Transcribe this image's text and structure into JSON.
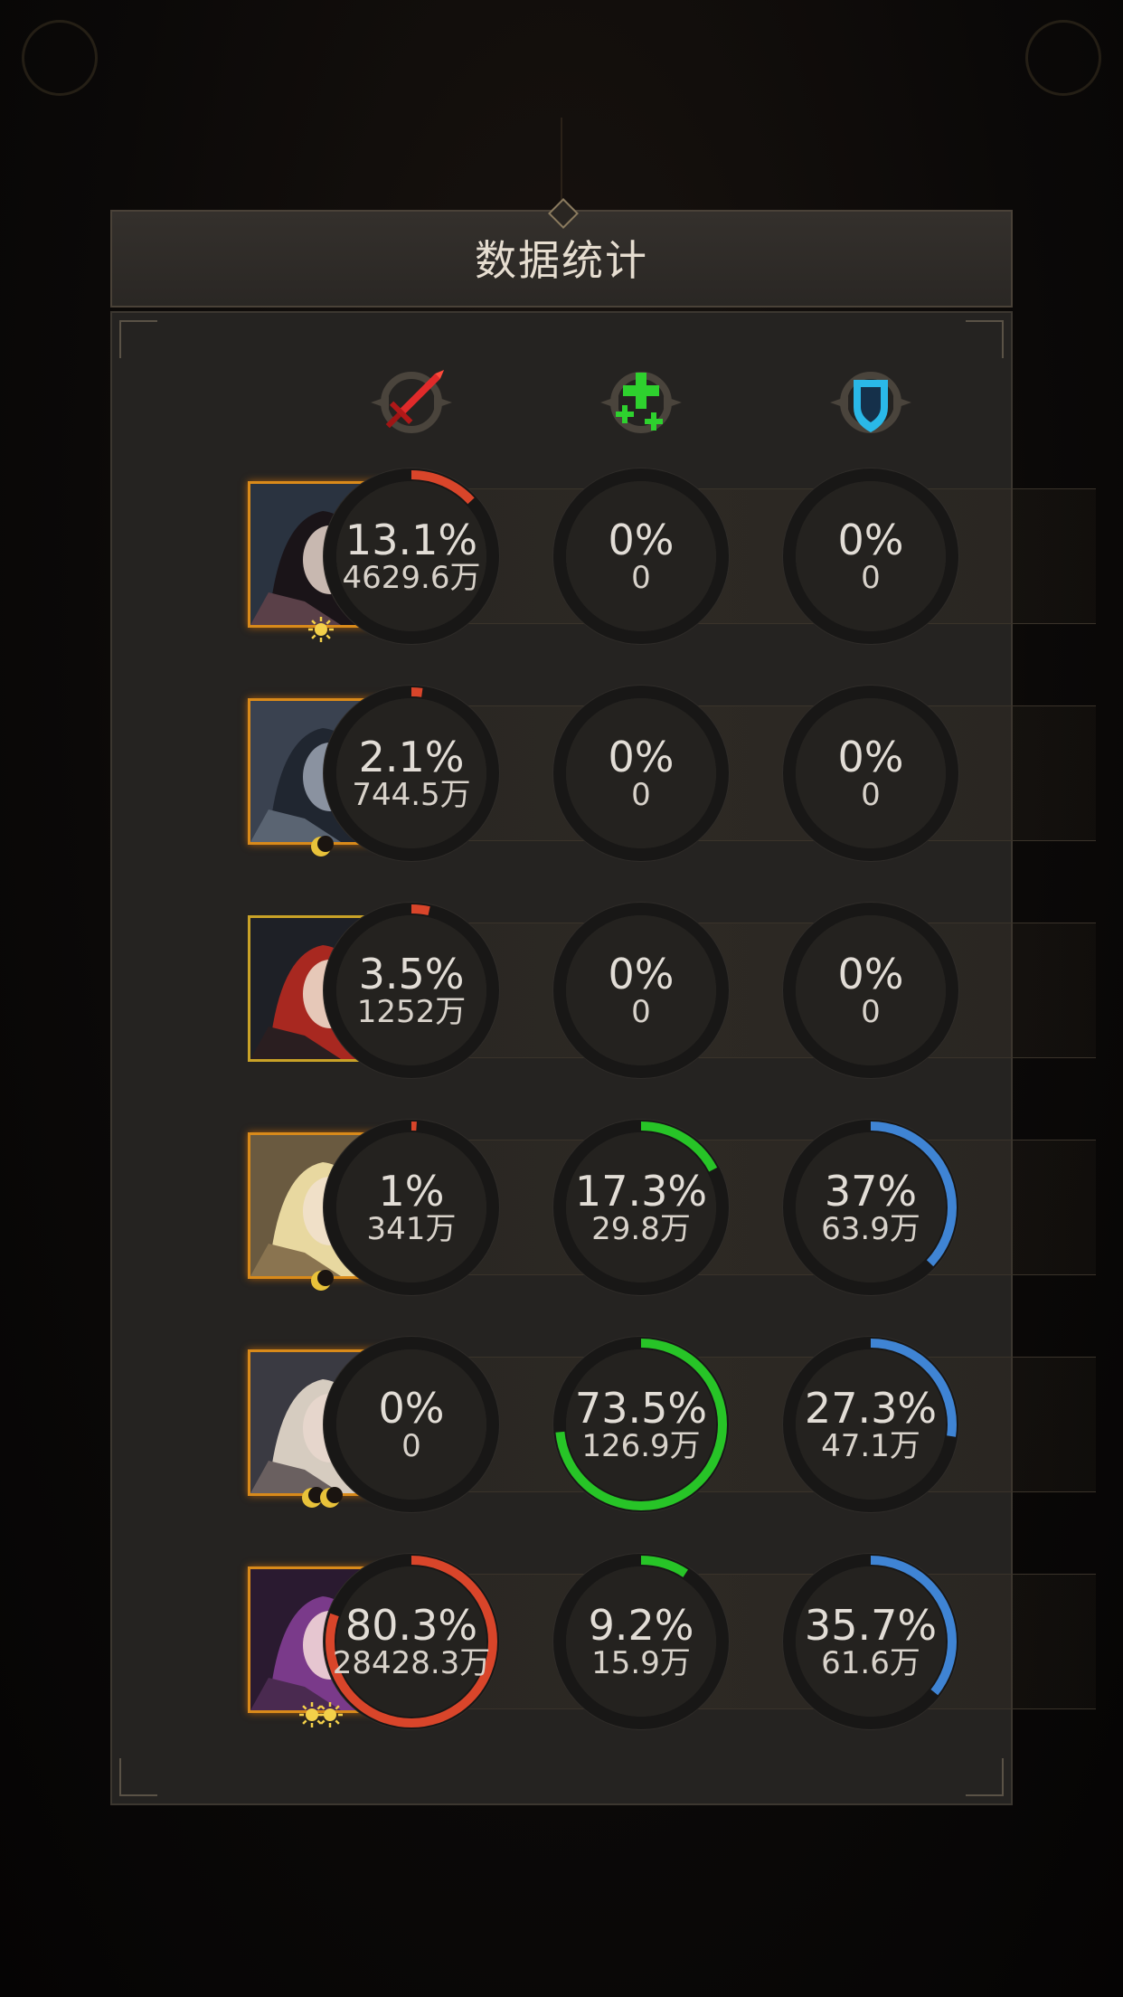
{
  "dialog": {
    "title": "数据统计"
  },
  "columns": [
    {
      "icon": "sword-icon",
      "color": "#e02a2a"
    },
    {
      "icon": "heal-plus-icon",
      "color": "#2ed12e"
    },
    {
      "icon": "shield-icon",
      "color": "#2ab8e8"
    }
  ],
  "ring_colors": {
    "damage": "#d9452a",
    "heal": "#27c427",
    "shield": "#3f84d4",
    "track": "#181716"
  },
  "rows": [
    {
      "portrait": "hero-dark-sorceress-portrait",
      "badge": "sun-badge-icon",
      "damage": {
        "pct": "13.1%",
        "value": "4629.6万",
        "fraction": 0.131
      },
      "heal": {
        "pct": "0%",
        "value": "0",
        "fraction": 0
      },
      "shield": {
        "pct": "0%",
        "value": "0",
        "fraction": 0
      }
    },
    {
      "portrait": "hero-werewolf-portrait",
      "badge": "moon-badge-icon",
      "damage": {
        "pct": "2.1%",
        "value": "744.5万",
        "fraction": 0.021
      },
      "heal": {
        "pct": "0%",
        "value": "0",
        "fraction": 0
      },
      "shield": {
        "pct": "0%",
        "value": "0",
        "fraction": 0
      }
    },
    {
      "portrait": "hero-red-hair-portrait",
      "badge": "",
      "damage": {
        "pct": "3.5%",
        "value": "1252万",
        "fraction": 0.035
      },
      "heal": {
        "pct": "0%",
        "value": "0",
        "fraction": 0
      },
      "shield": {
        "pct": "0%",
        "value": "0",
        "fraction": 0
      }
    },
    {
      "portrait": "hero-blonde-elf-portrait",
      "badge": "moon-badge-icon",
      "damage": {
        "pct": "1%",
        "value": "341万",
        "fraction": 0.01
      },
      "heal": {
        "pct": "17.3%",
        "value": "29.8万",
        "fraction": 0.173
      },
      "shield": {
        "pct": "37%",
        "value": "63.9万",
        "fraction": 0.37
      }
    },
    {
      "portrait": "hero-silver-hair-portrait",
      "badge": "double-moon-badge-icon",
      "damage": {
        "pct": "0%",
        "value": "0",
        "fraction": 0
      },
      "heal": {
        "pct": "73.5%",
        "value": "126.9万",
        "fraction": 0.735
      },
      "shield": {
        "pct": "27.3%",
        "value": "47.1万",
        "fraction": 0.273
      }
    },
    {
      "portrait": "hero-violet-witch-portrait",
      "badge": "double-sun-badge-icon",
      "damage": {
        "pct": "80.3%",
        "value": "28428.3万",
        "fraction": 0.803
      },
      "heal": {
        "pct": "9.2%",
        "value": "15.9万",
        "fraction": 0.092
      },
      "shield": {
        "pct": "35.7%",
        "value": "61.6万",
        "fraction": 0.357
      }
    }
  ]
}
